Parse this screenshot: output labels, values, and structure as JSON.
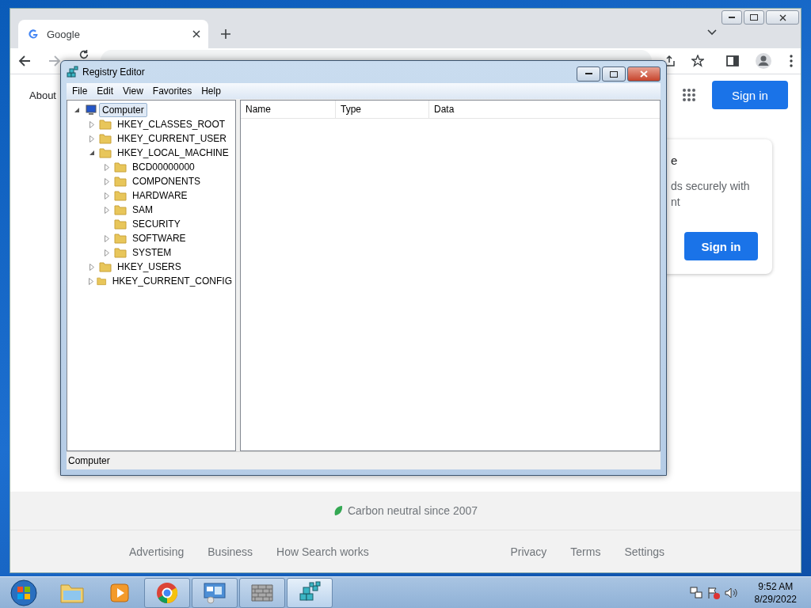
{
  "browser": {
    "tab": {
      "title": "Google"
    },
    "page": {
      "header_link": "About",
      "sign_in": "Sign in",
      "card": {
        "lines": [
          "e",
          "ds securely with",
          "nt"
        ],
        "button": "Sign in"
      },
      "footer": {
        "carbon": "Carbon neutral since 2007",
        "links_left": [
          "Advertising",
          "Business",
          "How Search works"
        ],
        "links_right": [
          "Privacy",
          "Terms",
          "Settings"
        ]
      }
    }
  },
  "registry_editor": {
    "title": "Registry Editor",
    "menu": [
      "File",
      "Edit",
      "View",
      "Favorites",
      "Help"
    ],
    "tree": [
      {
        "label": "Computer",
        "selected": true,
        "expanded": true,
        "children": [
          {
            "label": "HKEY_CLASSES_ROOT",
            "selected": false,
            "expanded": false,
            "has_children": true
          },
          {
            "label": "HKEY_CURRENT_USER",
            "selected": false,
            "expanded": false,
            "has_children": true
          },
          {
            "label": "HKEY_LOCAL_MACHINE",
            "selected": false,
            "expanded": true,
            "children": [
              {
                "label": "BCD00000000",
                "selected": false,
                "expanded": false,
                "has_children": true
              },
              {
                "label": "COMPONENTS",
                "selected": false,
                "expanded": false,
                "has_children": true
              },
              {
                "label": "HARDWARE",
                "selected": false,
                "expanded": false,
                "has_children": true
              },
              {
                "label": "SAM",
                "selected": false,
                "expanded": false,
                "has_children": true
              },
              {
                "label": "SECURITY",
                "selected": false,
                "has_children": false
              },
              {
                "label": "SOFTWARE",
                "selected": false,
                "expanded": false,
                "has_children": true
              },
              {
                "label": "SYSTEM",
                "selected": false,
                "expanded": false,
                "has_children": true
              }
            ]
          },
          {
            "label": "HKEY_USERS",
            "selected": false,
            "expanded": false,
            "has_children": true
          },
          {
            "label": "HKEY_CURRENT_CONFIG",
            "selected": false,
            "expanded": false,
            "has_children": true
          }
        ]
      }
    ],
    "columns": [
      "Name",
      "Type",
      "Data"
    ],
    "status": "Computer"
  },
  "taskbar": {
    "items": [
      {
        "kind": "folder",
        "running": false,
        "selected": false
      },
      {
        "kind": "media",
        "running": false,
        "selected": false
      },
      {
        "kind": "browser",
        "running": true,
        "selected": false
      },
      {
        "kind": "control_panel",
        "running": true,
        "selected": false
      },
      {
        "kind": "firewall",
        "running": true,
        "selected": false
      },
      {
        "kind": "registry",
        "running": true,
        "selected": true
      }
    ],
    "clock": {
      "time": "9:52 AM",
      "date": "8/29/2022"
    }
  }
}
